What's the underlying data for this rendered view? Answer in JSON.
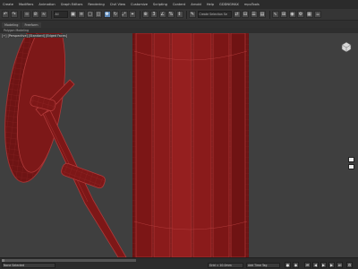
{
  "menu": {
    "items": [
      "Create",
      "Modifiers",
      "Animation",
      "Graph Editors",
      "Rendering",
      "Civil View",
      "Customize",
      "Scripting",
      "Content",
      "Arnold",
      "Help",
      "GDDNGMAX",
      "mpuTools"
    ]
  },
  "toolbar": {
    "selection_filter": "All",
    "named_selection": "Create Selection Se",
    "undo_icon": "undo-icon",
    "redo_icon": "redo-icon",
    "select_icon": "select-icon",
    "move_icon": "move-icon",
    "rotate_icon": "rotate-icon",
    "scale_icon": "scale-icon",
    "snap_label": "3",
    "angle_snap_label": "%"
  },
  "ribbon": {
    "tabs": [
      "Modeling",
      "Freeform"
    ],
    "sub_label": "Polygon Modeling"
  },
  "viewport": {
    "label": "[+] [Perspective] [Standard] [Edged Faces]",
    "colors": {
      "model_fill": "#7d1717",
      "model_edge": "#b23a3a",
      "background": "#3f3f3f"
    }
  },
  "status": {
    "timeline_position": 0,
    "selection_text": "None Selected",
    "coordinate_text": "Grid = 10.0mm",
    "add_time_tag": "Add Time Tag",
    "auto_key": "Auto Key",
    "set_key": "Set Key"
  }
}
